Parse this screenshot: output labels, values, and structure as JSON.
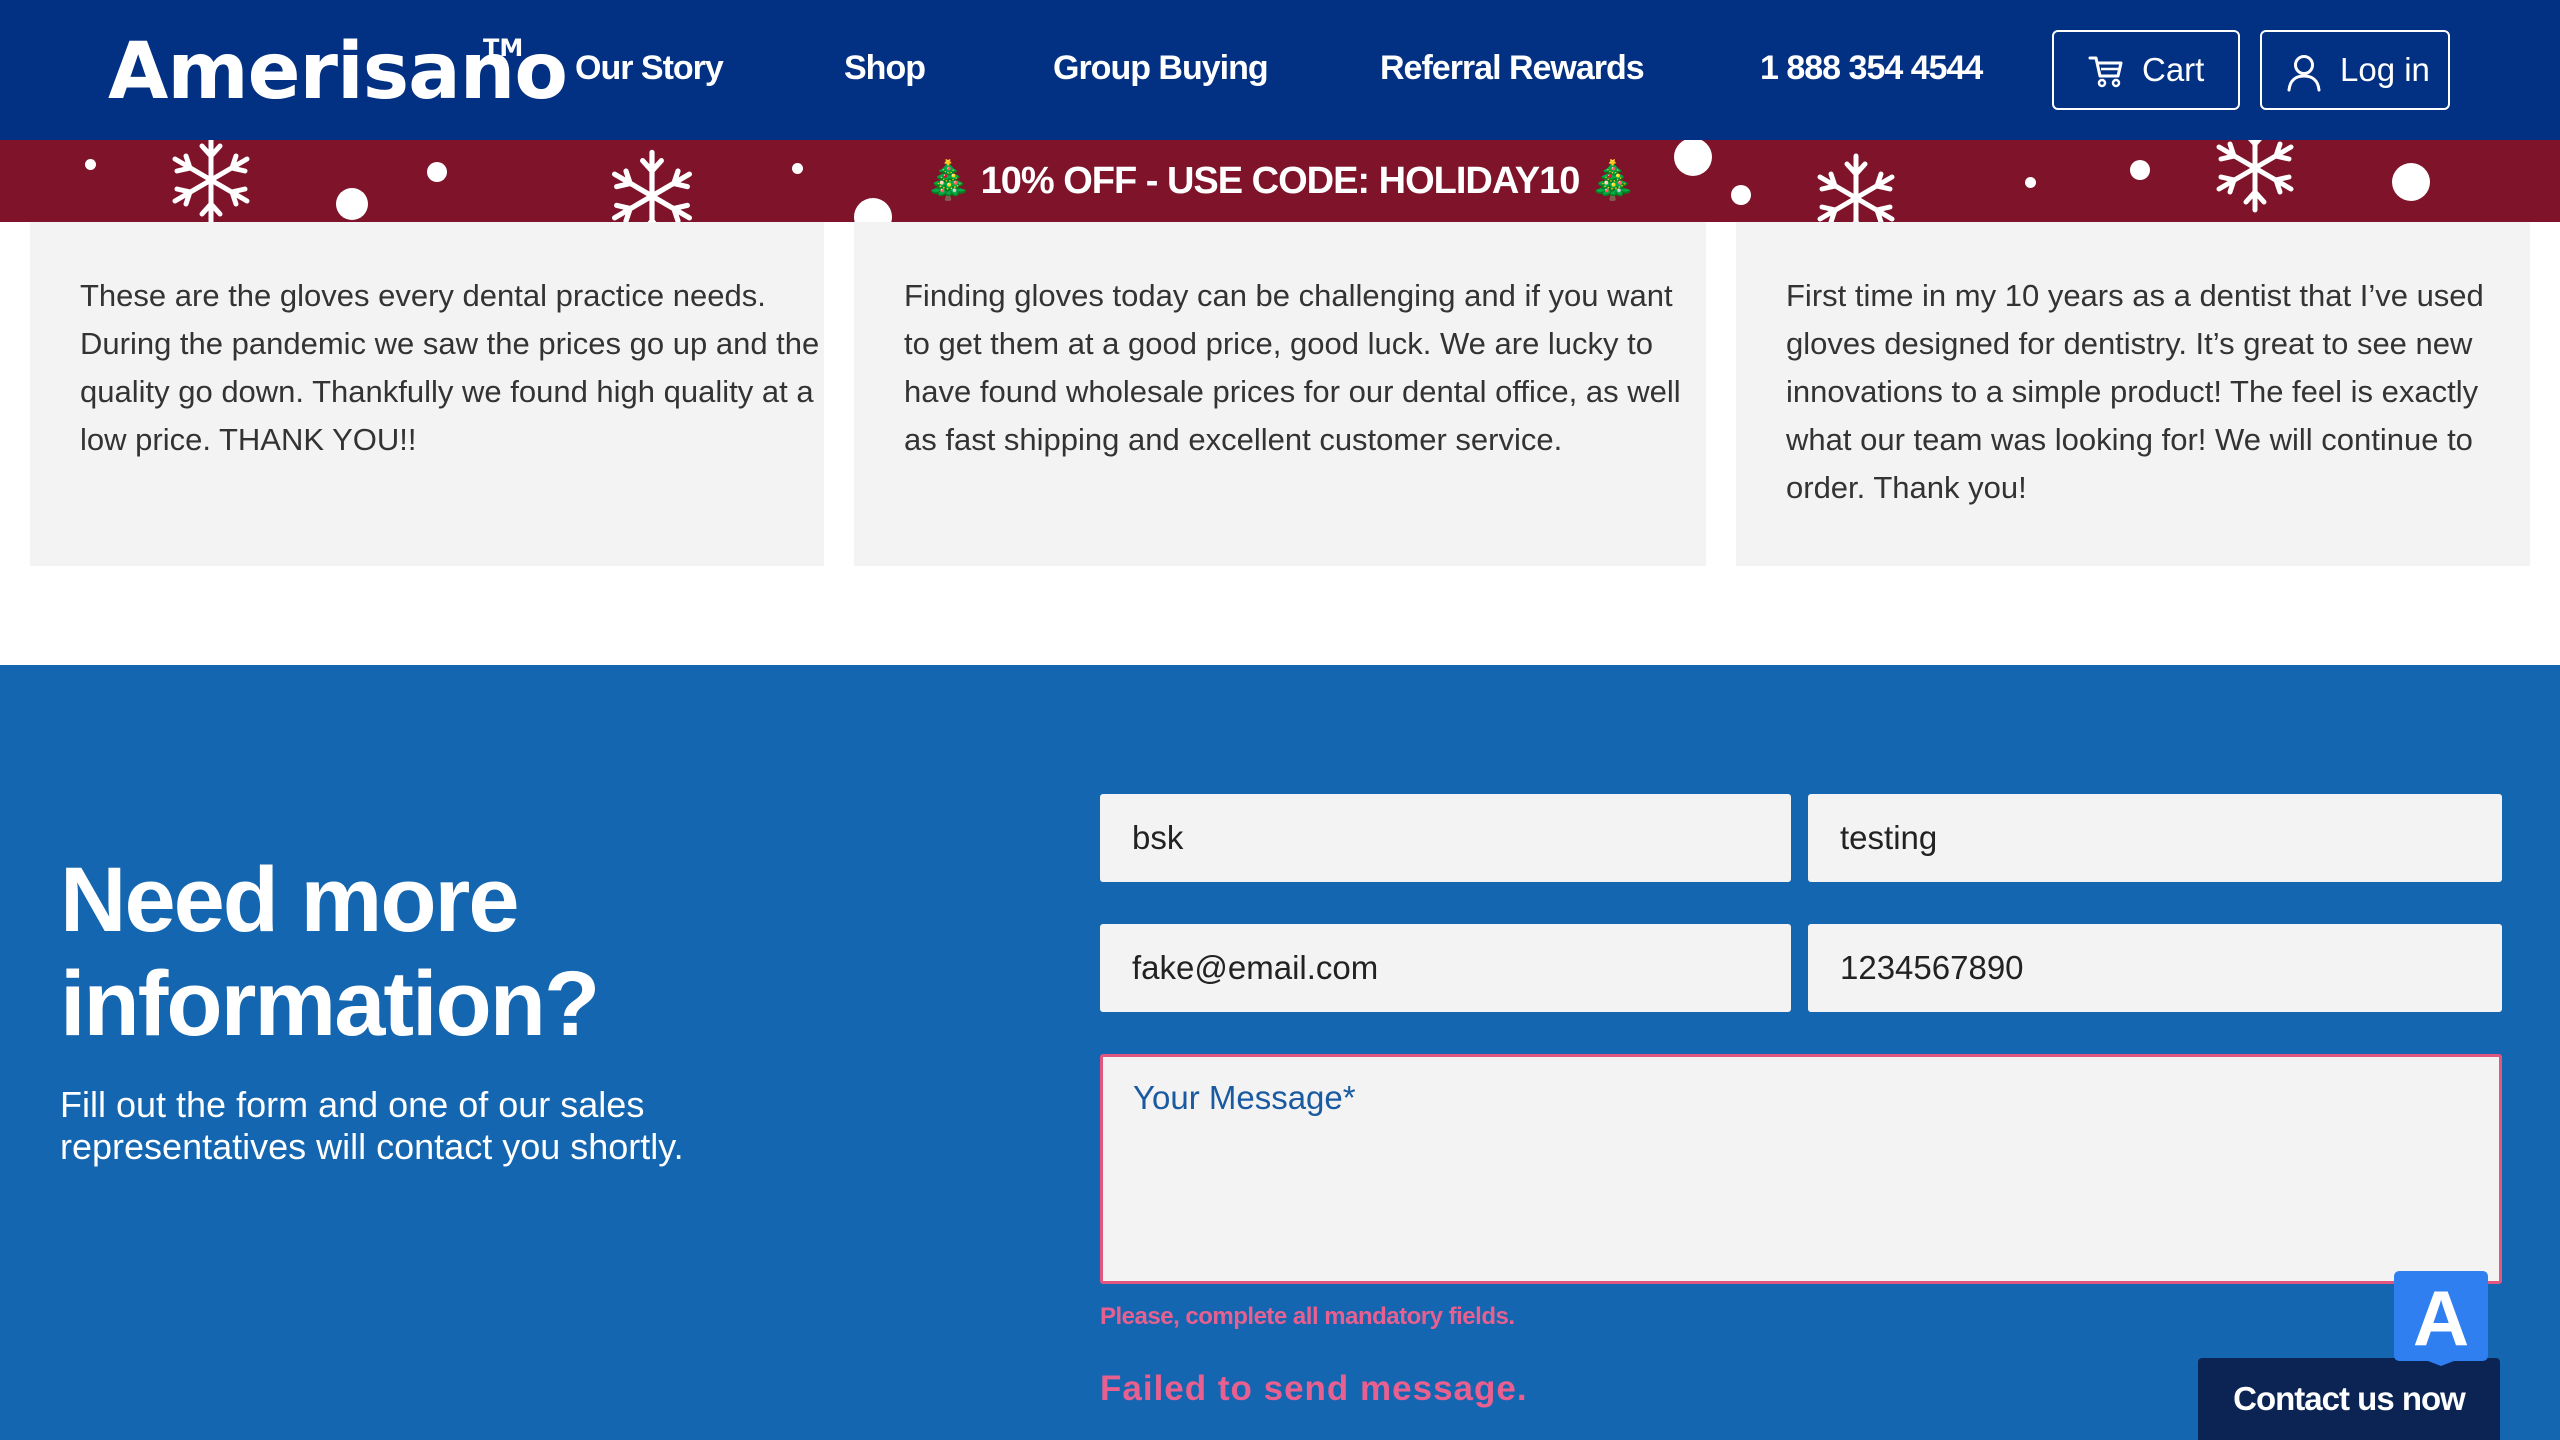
{
  "header": {
    "logo_text": "Amerisano",
    "logo_tm": "TM",
    "nav": [
      {
        "label": "Our Story"
      },
      {
        "label": "Shop"
      },
      {
        "label": "Group Buying"
      },
      {
        "label": "Referral Rewards"
      },
      {
        "label": "1 888 354 4544"
      }
    ],
    "cart_label": "Cart",
    "login_label": "Log in"
  },
  "promo": {
    "text": "🎄 10% OFF - USE CODE: HOLIDAY10 🎄"
  },
  "testimonials": [
    {
      "text": "These are the gloves every dental practice needs. During the pandemic we saw the prices go up and the quality go down. Thankfully we found high quality at a low price. THANK YOU!!"
    },
    {
      "text": "Finding gloves today can be challenging and if you want to get them at a good price, good luck. We are lucky to have found wholesale prices for our dental office, as well as fast shipping and excellent customer service."
    },
    {
      "text": "First time in my 10 years as a dentist that I’ve used gloves designed for dentistry. It’s great to see new innovations to a simple product! The feel is exactly what our team was looking for! We will continue to order. Thank you!"
    }
  ],
  "contact": {
    "title": "Need more information?",
    "subtitle": "Fill out the form and one of our sales representatives will contact you shortly.",
    "form": {
      "first_name": "bsk",
      "last_name": "testing",
      "email": "fake@email.com",
      "phone": "1234567890",
      "message_placeholder": "Your Message*",
      "message_value": ""
    },
    "validation_error": "Please, complete all mandatory fields.",
    "send_error": "Failed to send message.",
    "button_label": "Contact us now",
    "badge_letter": "A"
  },
  "colors": {
    "header_bg": "#023083",
    "promo_bg": "#7e132a",
    "contact_bg": "#1466b0",
    "error": "#e8608f",
    "button_bg": "#0b2454"
  }
}
